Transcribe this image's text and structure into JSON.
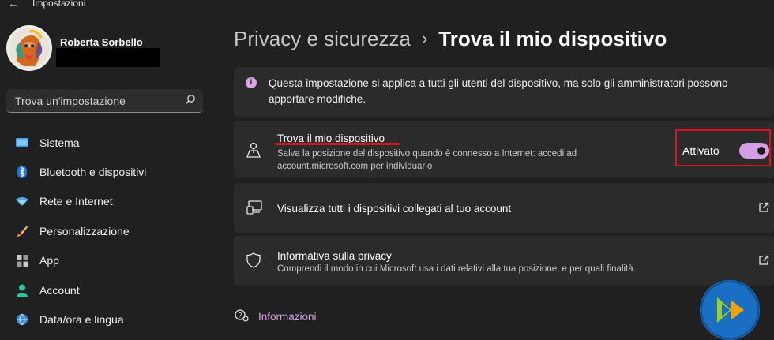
{
  "window": {
    "back_glyph": "←",
    "title": "Impostazioni"
  },
  "user": {
    "name": "Roberta Sorbello"
  },
  "search": {
    "placeholder": "Trova un'impostazione"
  },
  "nav": [
    {
      "label": "Sistema",
      "icon": "monitor-icon"
    },
    {
      "label": "Bluetooth e dispositivi",
      "icon": "bluetooth-icon"
    },
    {
      "label": "Rete e Internet",
      "icon": "wifi-icon"
    },
    {
      "label": "Personalizzazione",
      "icon": "brush-icon"
    },
    {
      "label": "App",
      "icon": "apps-icon"
    },
    {
      "label": "Account",
      "icon": "person-icon"
    },
    {
      "label": "Data/ora e lingua",
      "icon": "globe-clock-icon"
    }
  ],
  "breadcrumb": {
    "parent": "Privacy e sicurezza",
    "separator": "›",
    "current": "Trova il mio dispositivo"
  },
  "info_banner": {
    "text": "Questa impostazione si applica a tutti gli utenti del dispositivo, ma solo gli amministratori possono apportare modifiche."
  },
  "find_device": {
    "title": "Trova il mio dispositivo",
    "subtitle_line1": "Salva la posizione del dispositivo quando è connesso a Internet: accedi ad",
    "subtitle_line2": "account.microsoft.com per individuarlo",
    "toggle_label": "Attivato",
    "toggle_on": true
  },
  "devices_link": {
    "title": "Visualizza tutti i dispositivi collegati al tuo account"
  },
  "privacy_link": {
    "title": "Informativa sulla privacy",
    "subtitle": "Comprendi il modo in cui Microsoft usa i dati relativi alla tua posizione, e per quali finalità."
  },
  "footer_link": {
    "label": "Informazioni"
  },
  "colors": {
    "background": "#202020",
    "card": "#2b2b2b",
    "accent": "#d59ee5",
    "highlight": "#e0101a"
  }
}
